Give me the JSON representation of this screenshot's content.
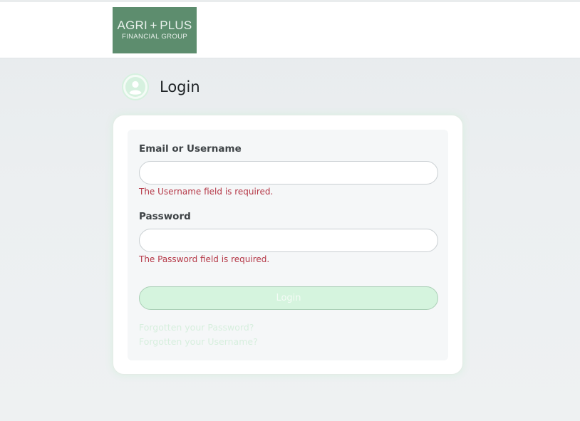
{
  "header": {
    "logo": {
      "line1": "AGRI + PLUS",
      "line2": "FINANCIAL GROUP"
    }
  },
  "page": {
    "title": "Login",
    "icon": "user-circle-icon"
  },
  "form": {
    "username": {
      "label": "Email or Username",
      "value": "",
      "placeholder": "",
      "error": "The Username field is required."
    },
    "password": {
      "label": "Password",
      "value": "",
      "placeholder": "",
      "error": "The Password field is required."
    },
    "submit_label": "Login",
    "forgot_password": "Forgotten your Password?",
    "forgot_username": "Forgotten your Username?"
  },
  "colors": {
    "brand_green": "#5d8d6e",
    "accent_light_green": "#d5f4de",
    "error_red": "#b53847"
  }
}
